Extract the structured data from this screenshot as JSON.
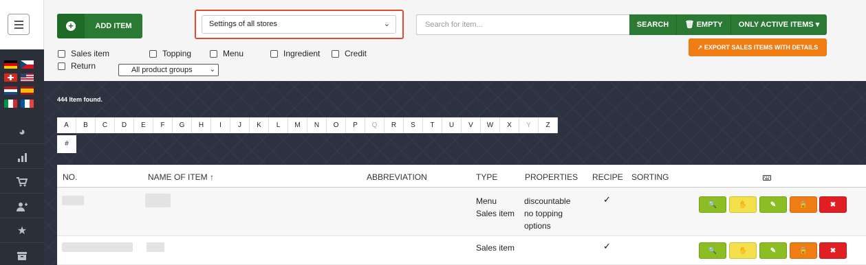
{
  "sidebar": {
    "menu_icon": "hamburger-menu-icon",
    "flags": [
      "de",
      "cz",
      "ch",
      "us",
      "nl",
      "es",
      "it",
      "fr"
    ],
    "nav_icons": [
      "dashboard-gauge-icon",
      "bar-chart-icon",
      "shopping-cart-icon",
      "add-user-icon",
      "star-icon",
      "archive-icon"
    ]
  },
  "toolbar": {
    "add_item_label": "ADD ITEM",
    "store_select_value": "Settings of all stores",
    "search_placeholder": "Search for item...",
    "search_label": "SEARCH",
    "empty_label": "EMPTY",
    "only_active_label": "ONLY ACTIVE ITEMS",
    "export_label": "EXPORT SALES ITEMS WITH DETAILS"
  },
  "filters": {
    "checkboxes": [
      {
        "label": "Sales item",
        "checked": false
      },
      {
        "label": "Topping",
        "checked": false
      },
      {
        "label": "Menu",
        "checked": false
      },
      {
        "label": "Ingredient",
        "checked": false
      },
      {
        "label": "Credit",
        "checked": false
      },
      {
        "label": "Return",
        "checked": false
      }
    ],
    "product_group_value": "All product groups"
  },
  "results": {
    "found_text": "444 Item found."
  },
  "alphabet": {
    "letters": [
      "A",
      "B",
      "C",
      "D",
      "E",
      "F",
      "G",
      "H",
      "I",
      "J",
      "K",
      "L",
      "M",
      "N",
      "O",
      "P",
      "Q",
      "R",
      "S",
      "T",
      "U",
      "V",
      "W",
      "X",
      "Y",
      "Z"
    ],
    "dimmed": [
      "Q",
      "Y"
    ],
    "extra": "#"
  },
  "table": {
    "headers": {
      "no": "NO.",
      "name": "NAME OF ITEM ↑",
      "abbreviation": "ABBREVIATION",
      "type": "TYPE",
      "properties": "PROPERTIES",
      "recipe": "RECIPE",
      "sorting": "SORTING",
      "keyboard_icon": "keyboard-icon"
    },
    "rows": [
      {
        "type_line1": "Menu",
        "type_line2": "Sales item",
        "prop_line1": "discountable",
        "prop_line2": "no topping",
        "prop_line3": "options",
        "recipe": "✓"
      },
      {
        "type_line1": "Sales item",
        "type_line2": "",
        "prop_line1": "",
        "prop_line2": "",
        "prop_line3": "",
        "recipe": "✓"
      }
    ]
  },
  "colors": {
    "primary_green": "#2a7a34",
    "highlight_red": "#e04a2f",
    "export_orange": "#f07c14",
    "sidebar_bg": "#2b2f3a",
    "content_bg": "#2c3240"
  }
}
